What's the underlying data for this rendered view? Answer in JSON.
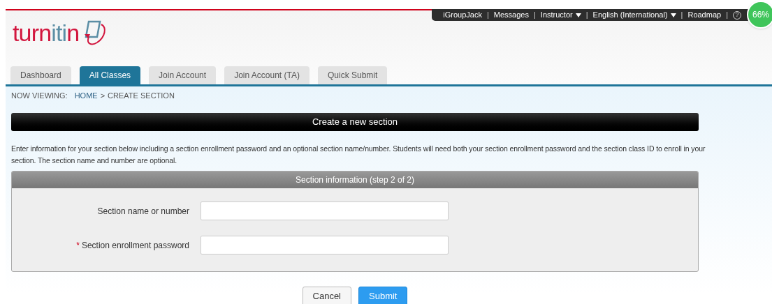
{
  "top_bar": {
    "items": [
      {
        "label": "iGroupJack",
        "dropdown": false
      },
      {
        "label": "Messages",
        "dropdown": false
      },
      {
        "label": "Instructor",
        "dropdown": true
      },
      {
        "label": "English (International)",
        "dropdown": true
      },
      {
        "label": "Roadmap",
        "dropdown": false
      }
    ],
    "separator": "|",
    "help": "?",
    "progress_badge": "66%"
  },
  "logo": {
    "parts": [
      {
        "text": "turn",
        "color": "#d2163e"
      },
      {
        "text": "iti",
        "color": "#5b8ea5"
      },
      {
        "text": "n",
        "color": "#d2163e"
      }
    ]
  },
  "tabs": [
    {
      "label": "Dashboard",
      "selected": false
    },
    {
      "label": "All Classes",
      "selected": true
    },
    {
      "label": "Join Account",
      "selected": false
    },
    {
      "label": "Join Account (TA)",
      "selected": false
    },
    {
      "label": "Quick Submit",
      "selected": false
    }
  ],
  "breadcrumb": {
    "prefix": "NOW VIEWING:",
    "items": [
      "HOME",
      "CREATE SECTION"
    ],
    "separator": ">"
  },
  "page_title": "Create a new section",
  "description": "Enter information for your section below including a section enrollment password and an optional section name/number. Students will need both your section enrollment password and the section class ID to enroll in your section. The section name and number are optional.",
  "panel": {
    "title": "Section information (step 2 of 2)",
    "required_mark": "*",
    "fields": [
      {
        "label": "Section name or number",
        "required": false
      },
      {
        "label": "Section enrollment password",
        "required": true
      }
    ]
  },
  "buttons": [
    {
      "label": "Cancel",
      "kind": "secondary"
    },
    {
      "label": "Submit",
      "kind": "primary"
    }
  ]
}
